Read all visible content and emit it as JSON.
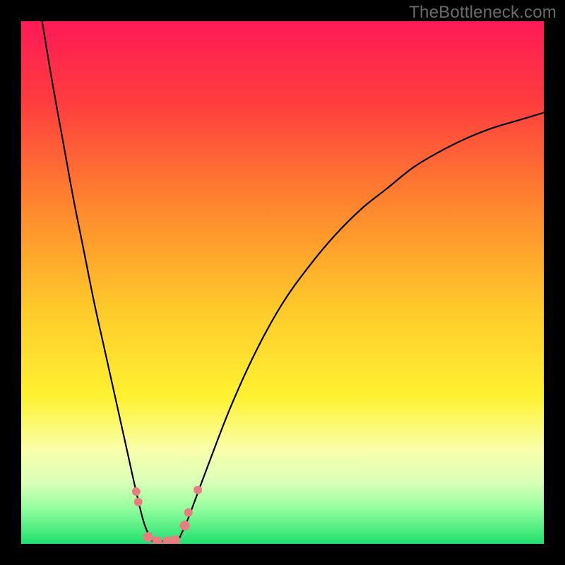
{
  "watermark": "TheBottleneck.com",
  "chart_data": {
    "type": "line",
    "title": "",
    "xlabel": "",
    "ylabel": "",
    "xlim": [
      0,
      100
    ],
    "ylim": [
      0,
      100
    ],
    "grid": false,
    "legend": false,
    "background_gradient": {
      "stops": [
        {
          "offset": 0.0,
          "color": "#ff1a57"
        },
        {
          "offset": 0.15,
          "color": "#ff3b3f"
        },
        {
          "offset": 0.35,
          "color": "#ff852e"
        },
        {
          "offset": 0.55,
          "color": "#ffca2b"
        },
        {
          "offset": 0.72,
          "color": "#fff232"
        },
        {
          "offset": 0.82,
          "color": "#f9ffab"
        },
        {
          "offset": 0.88,
          "color": "#dcffb9"
        },
        {
          "offset": 0.93,
          "color": "#98ff9e"
        },
        {
          "offset": 1.0,
          "color": "#1fe06f"
        }
      ]
    },
    "series": [
      {
        "name": "left-curve",
        "note": "values estimated from gridless plot; y is percent of plot height from bottom",
        "x": [
          4,
          6,
          8,
          10,
          12,
          14,
          16,
          18,
          20,
          22,
          23.5,
          25
        ],
        "y": [
          100,
          88,
          77,
          66,
          56,
          46,
          37,
          28,
          19,
          10,
          4,
          0.5
        ]
      },
      {
        "name": "right-curve",
        "note": "values estimated from gridless plot; y is percent of plot height from bottom",
        "x": [
          30,
          32,
          35,
          40,
          45,
          50,
          55,
          60,
          65,
          70,
          75,
          80,
          85,
          90,
          95,
          100
        ],
        "y": [
          0.5,
          5,
          13,
          26,
          37,
          46,
          53,
          59,
          64,
          68,
          72,
          75,
          77.5,
          79.5,
          81,
          82.5
        ]
      },
      {
        "name": "valley-floor",
        "note": "flat segment joining the two curves at the bottom",
        "x": [
          25,
          27.5,
          30
        ],
        "y": [
          0.5,
          0.5,
          0.5
        ]
      }
    ],
    "markers": {
      "name": "bottleneck-points",
      "color": "#e77e80",
      "points": [
        {
          "x": 22.0,
          "y": 10.0,
          "r": 6
        },
        {
          "x": 22.4,
          "y": 8.0,
          "r": 6
        },
        {
          "x": 24.3,
          "y": 1.3,
          "r": 7
        },
        {
          "x": 26.0,
          "y": 0.5,
          "r": 7
        },
        {
          "x": 28.0,
          "y": 0.5,
          "r": 7
        },
        {
          "x": 29.5,
          "y": 0.7,
          "r": 7
        },
        {
          "x": 31.3,
          "y": 3.5,
          "r": 7
        },
        {
          "x": 32.0,
          "y": 6.0,
          "r": 6
        },
        {
          "x": 33.8,
          "y": 10.3,
          "r": 6
        }
      ]
    }
  }
}
